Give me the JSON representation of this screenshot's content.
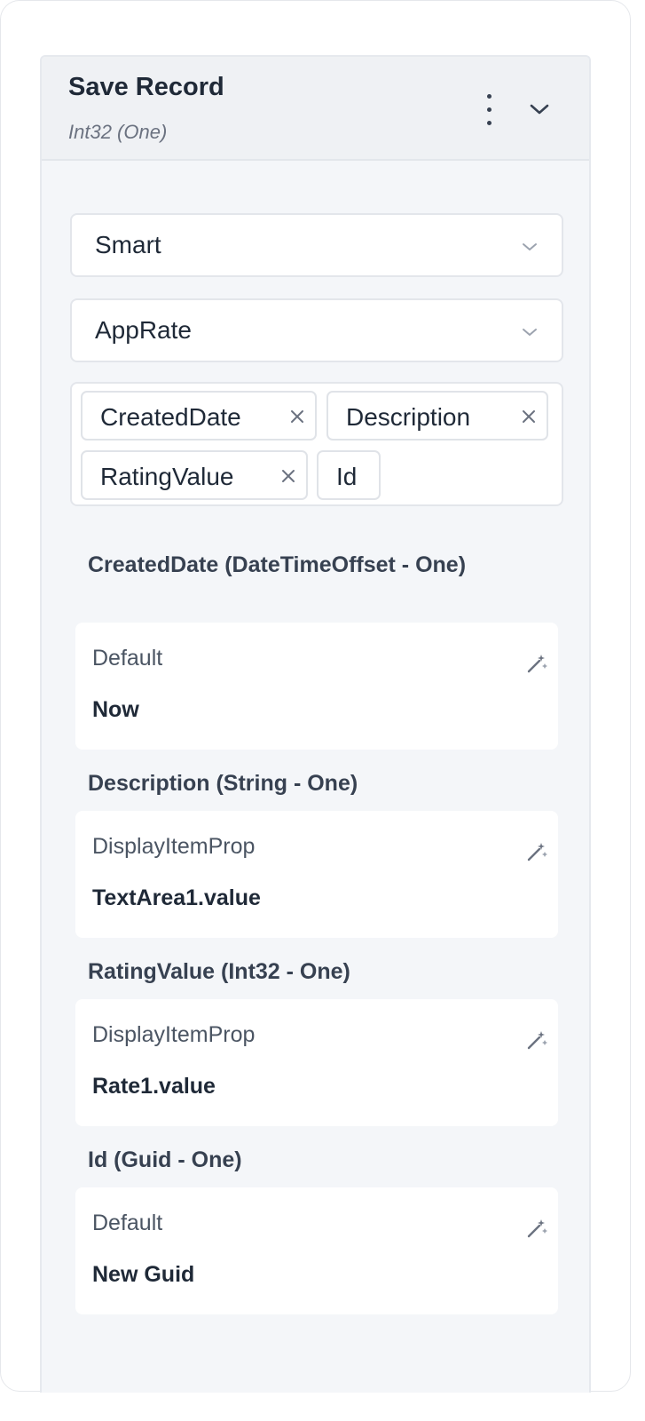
{
  "header": {
    "title": "Save Record",
    "subtitle": "Int32 (One)"
  },
  "selects": [
    {
      "value": "Smart"
    },
    {
      "value": "AppRate"
    }
  ],
  "fields_tags": [
    {
      "label": "CreatedDate",
      "removable": true
    },
    {
      "label": "Description",
      "removable": true
    },
    {
      "label": "RatingValue",
      "removable": true
    },
    {
      "label": "Id",
      "removable": false
    }
  ],
  "mappings": [
    {
      "label": "CreatedDate (DateTimeOffset - One)",
      "mode": "Default",
      "value": "Now"
    },
    {
      "label": "Description (String - One)",
      "mode": "DisplayItemProp",
      "value": "TextArea1.value"
    },
    {
      "label": "RatingValue (Int32 - One)",
      "mode": "DisplayItemProp",
      "value": "Rate1.value"
    },
    {
      "label": "Id (Guid - One)",
      "mode": "Default",
      "value": "New Guid"
    }
  ],
  "icons": {
    "menu": "kebab-menu-icon",
    "collapse": "chevron-down-icon",
    "remove": "close-icon",
    "expression": "magic-wand-icon"
  },
  "colors": {
    "panel_bg": "#f4f6f9",
    "header_bg": "#eff1f4",
    "text": "#1f2937",
    "muted": "#6b7280"
  }
}
